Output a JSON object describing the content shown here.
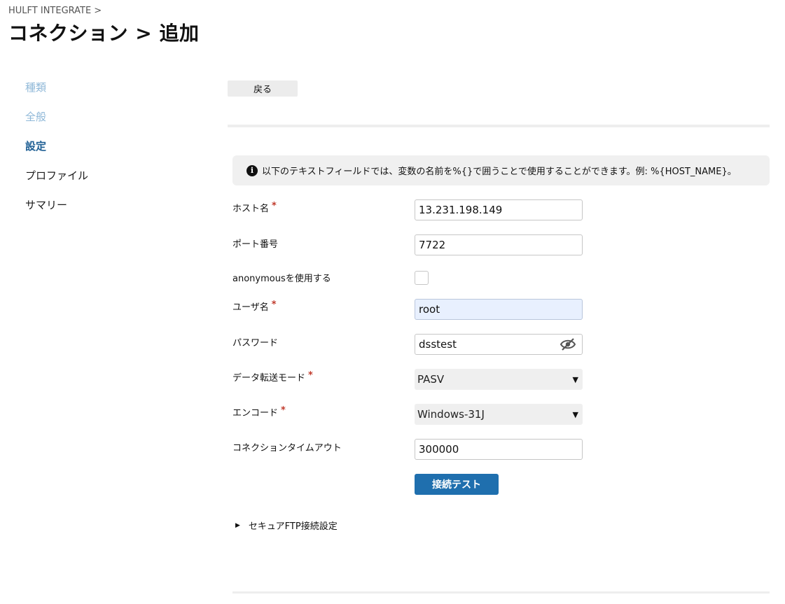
{
  "breadcrumb": {
    "root": "HULFT INTEGRATE",
    "separator": ">"
  },
  "title": "コネクション > 追加",
  "steps": [
    {
      "label": "種類",
      "state": "done"
    },
    {
      "label": "全般",
      "state": "done"
    },
    {
      "label": "設定",
      "state": "current"
    },
    {
      "label": "プロファイル",
      "state": "pending"
    },
    {
      "label": "サマリー",
      "state": "pending"
    }
  ],
  "back_button": "戻る",
  "info": {
    "icon": "info-icon",
    "text": "以下のテキストフィールドでは、変数の名前を%{}で囲うことで使用することができます。例: %{HOST_NAME}。"
  },
  "fields": {
    "host": {
      "label": "ホスト名",
      "required": "*",
      "value": "13.231.198.149"
    },
    "port": {
      "label": "ポート番号",
      "value": "7722"
    },
    "anonymous": {
      "label": "anonymousを使用する",
      "checked": false
    },
    "user": {
      "label": "ユーザ名",
      "required": "*",
      "value": "root"
    },
    "password": {
      "label": "パスワード",
      "value": "dsstest",
      "icon": "eye-slash-icon"
    },
    "transfer_mode": {
      "label": "データ転送モード",
      "required": "*",
      "value": "PASV"
    },
    "encoding": {
      "label": "エンコード",
      "required": "*",
      "value": "Windows-31J"
    },
    "timeout": {
      "label": "コネクションタイムアウト",
      "value": "300000"
    }
  },
  "test_button": "接続テスト",
  "secure_ftp": {
    "label": "セキュアFTP接続設定",
    "expanded": false
  },
  "colors": {
    "accent": "#1f6fae",
    "step_current": "#1f5f94",
    "step_done": "#8fb8d8",
    "required": "#c0392b"
  }
}
